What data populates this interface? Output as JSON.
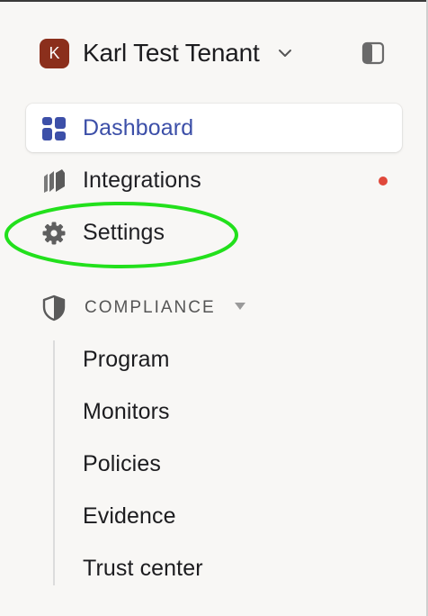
{
  "tenant": {
    "initial": "K",
    "name": "Karl Test Tenant",
    "avatar_color": "#8b2f1c"
  },
  "nav": {
    "items": [
      {
        "label": "Dashboard",
        "icon": "dashboard-icon",
        "active": true
      },
      {
        "label": "Integrations",
        "icon": "integrations-icon",
        "notification": true
      },
      {
        "label": "Settings",
        "icon": "gear-icon"
      }
    ],
    "accent_color": "#3c4fa8",
    "notification_color": "#e0483a"
  },
  "compliance": {
    "label": "COMPLIANCE",
    "icon": "shield-icon",
    "items": [
      "Program",
      "Monitors",
      "Policies",
      "Evidence",
      "Trust center"
    ]
  },
  "annotation": {
    "highlight_color": "#22e01c",
    "highlight_target": "Settings"
  }
}
